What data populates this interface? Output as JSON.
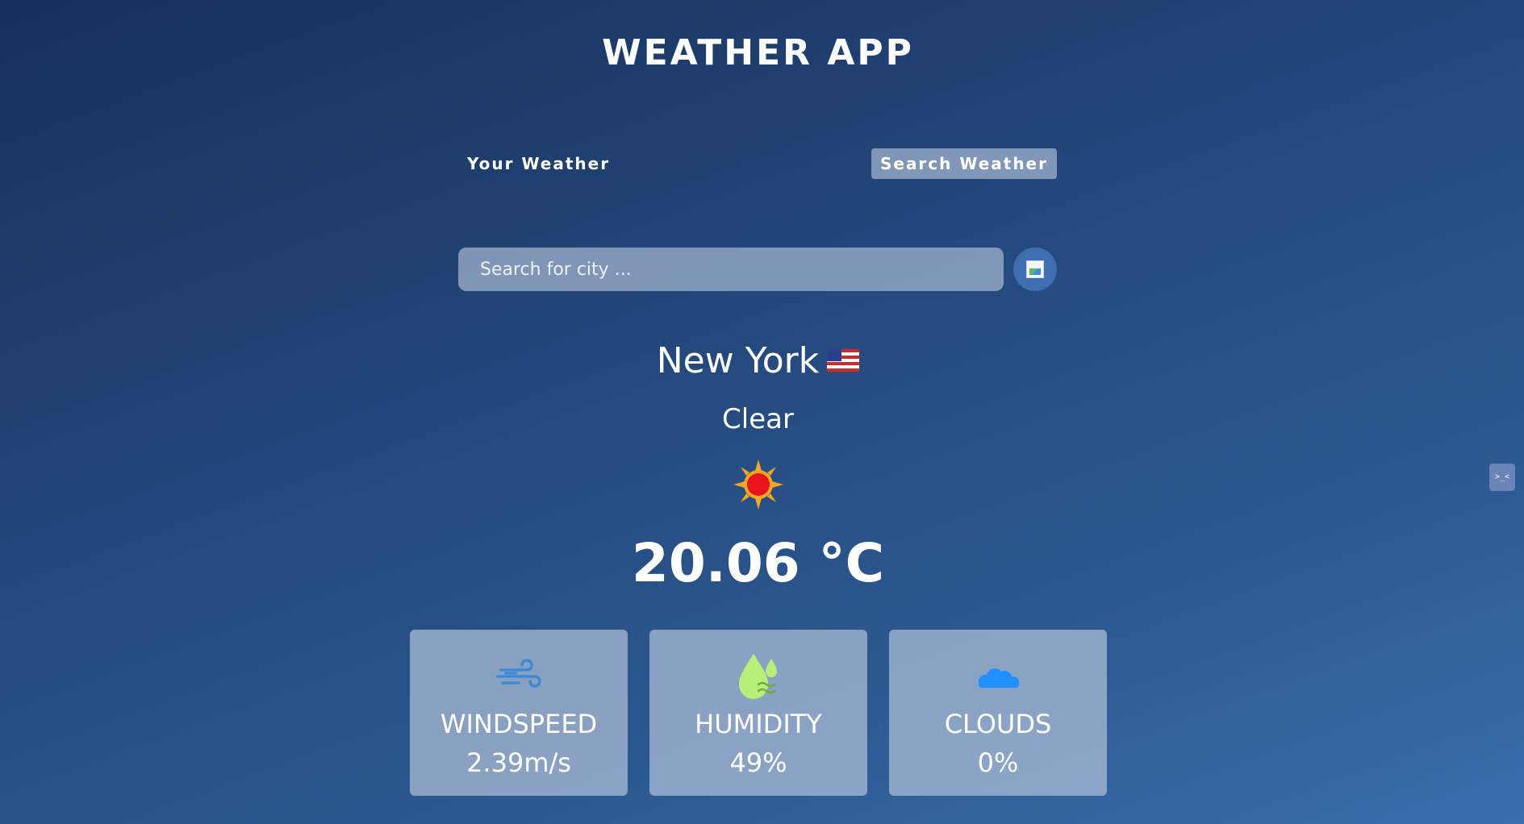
{
  "app": {
    "title": "WEATHER APP"
  },
  "tabs": {
    "your_weather": "Your Weather",
    "search_weather": "Search Weather",
    "active": "search_weather"
  },
  "search": {
    "placeholder": "Search for city ...",
    "value": "",
    "button_icon": "broken-image-icon"
  },
  "weather": {
    "city": "New York",
    "country_flag": "us-flag-icon",
    "condition": "Clear",
    "condition_icon": "sun-icon",
    "temperature": "20.06 °C"
  },
  "stats": [
    {
      "label": "WINDSPEED",
      "value": "2.39m/s",
      "icon": "wind-icon"
    },
    {
      "label": "HUMIDITY",
      "value": "49%",
      "icon": "humidity-icon"
    },
    {
      "label": "CLOUDS",
      "value": "0%",
      "icon": "cloud-icon"
    }
  ],
  "side_widget": {
    "text": ">_<"
  },
  "colors": {
    "wind_icon": "#3b8ad6",
    "humidity_icon": "#b8ee7a",
    "cloud_icon": "#1e90ff",
    "sun_core": "#e8141a",
    "sun_rays": "#f5a623"
  }
}
